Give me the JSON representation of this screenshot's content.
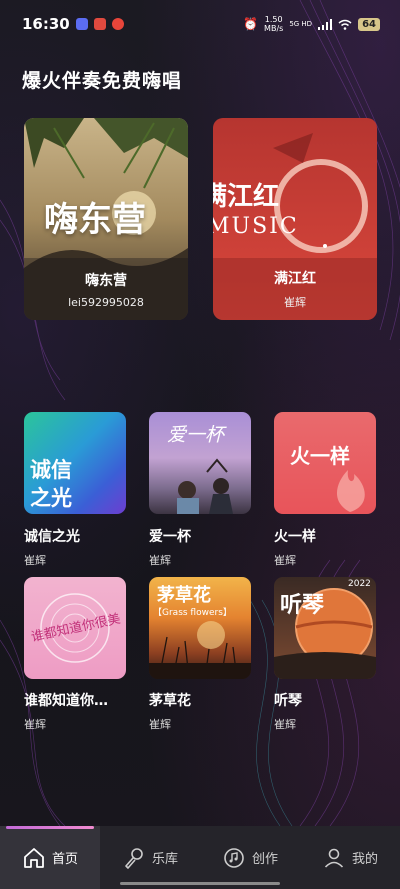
{
  "status_bar": {
    "time": "16:30",
    "speed_value": "1.50",
    "speed_unit": "MB/s",
    "network": "5G HD",
    "battery": "64"
  },
  "page_title": "爆火伴奏免费嗨唱",
  "featured": [
    {
      "title": "嗨东营",
      "subtitle": "lei592995028",
      "art_text": "嗨东营"
    },
    {
      "title": "满江红",
      "subtitle": "崔辉",
      "art_text": "满江红",
      "art_subtext": "MUSIC"
    }
  ],
  "songs": [
    {
      "title": "诚信之光",
      "artist": "崔辉",
      "art_text": "诚信之光"
    },
    {
      "title": "爱一杯",
      "artist": "崔辉",
      "art_text": "爱一杯"
    },
    {
      "title": "火一样",
      "artist": "崔辉",
      "art_text": "火一样"
    },
    {
      "title": "谁都知道你…",
      "artist": "崔辉",
      "art_text": "谁都知道你很美"
    },
    {
      "title": "茅草花",
      "artist": "崔辉",
      "art_text": "茅草花",
      "art_subtext": "【Grass flowers】"
    },
    {
      "title": "听琴",
      "artist": "崔辉",
      "art_text": "听琴",
      "art_subtext": "2022"
    }
  ],
  "nav": [
    {
      "label": "首页",
      "icon": "home-icon",
      "active": true
    },
    {
      "label": "乐库",
      "icon": "microphone-icon",
      "active": false
    },
    {
      "label": "创作",
      "icon": "music-disc-icon",
      "active": false
    },
    {
      "label": "我的",
      "icon": "person-icon",
      "active": false
    }
  ]
}
